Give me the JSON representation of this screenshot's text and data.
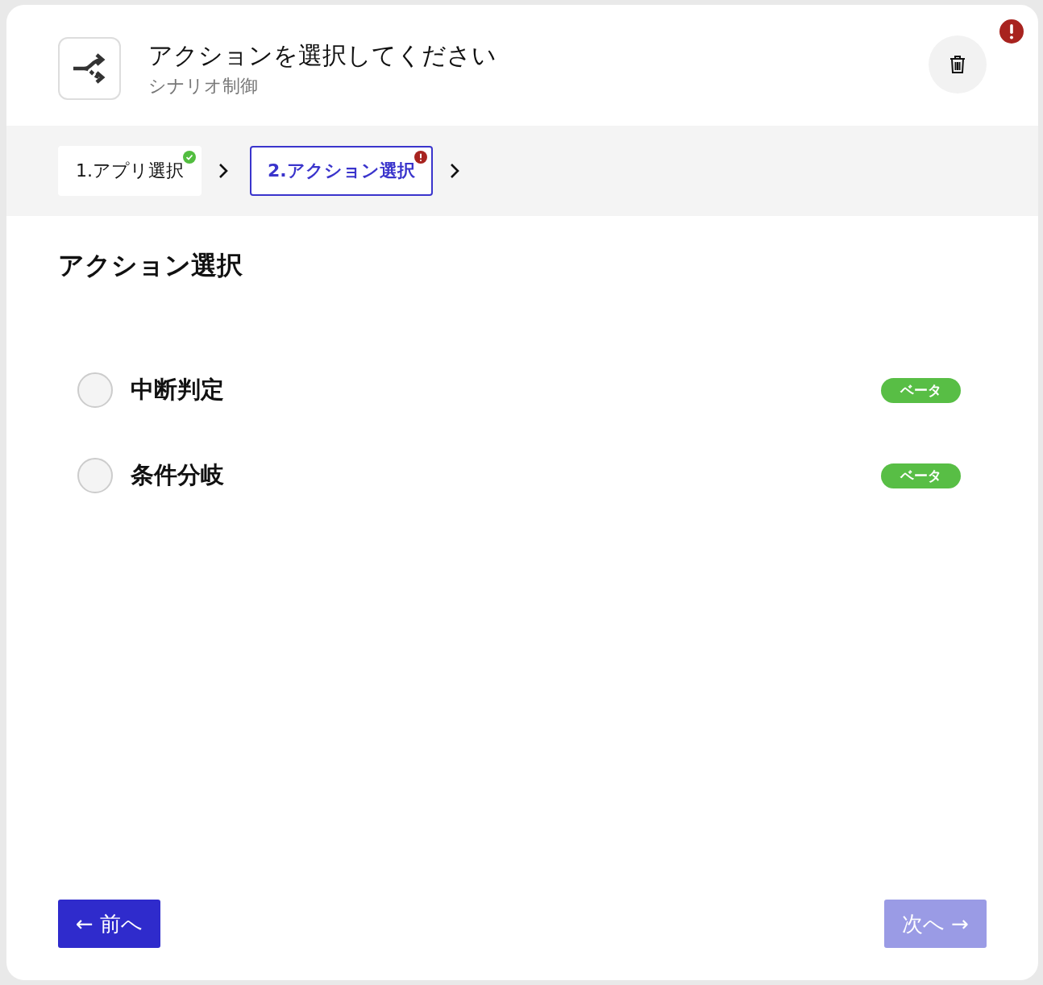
{
  "header": {
    "title": "アクションを選択してください",
    "subtitle": "シナリオ制御",
    "alert": true
  },
  "steps": [
    {
      "label": "1.アプリ選択",
      "selected": false,
      "kind": "done"
    },
    {
      "label": "2.アクション選択",
      "selected": true,
      "kind": "error"
    }
  ],
  "section_title": "アクション選択",
  "options": [
    {
      "label": "中断判定",
      "selected": false,
      "badge": "ベータ"
    },
    {
      "label": "条件分岐",
      "selected": false,
      "badge": "ベータ"
    }
  ],
  "buttons": {
    "prev": {
      "label": "← 前へ",
      "disabled": false
    },
    "next": {
      "label": "次へ →",
      "disabled": true
    }
  }
}
